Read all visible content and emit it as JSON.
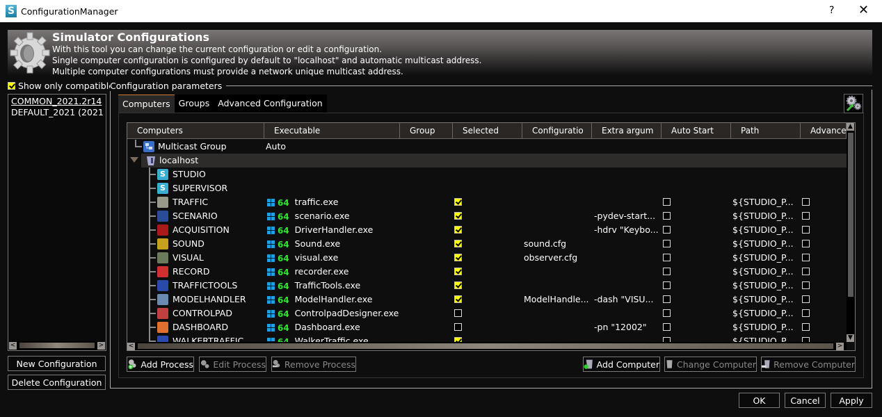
{
  "window": {
    "title": "ConfigurationManager",
    "help": "?",
    "close": "✕"
  },
  "banner": {
    "title": "Simulator Configurations",
    "lines": [
      "With this tool you can change the current configuration or edit a configuration.",
      "Single computer configuration is configured by default to \"localhost\" and automatic multicast address.",
      "Multiple computer configurations must provide a network unique multicast address."
    ]
  },
  "left": {
    "show_only_compatible": {
      "label": "Show only compatible",
      "checked": true
    },
    "configurations": [
      "COMMON_2021.2r14",
      "DEFAULT_2021 (2021"
    ],
    "selected_index": 0,
    "new_button": "New Configuration",
    "delete_button": "Delete Configuration"
  },
  "params": {
    "group_title": "Configuration parameters",
    "tabs": [
      "Computers",
      "Groups",
      "Advanced Configuration"
    ],
    "active_tab": 0
  },
  "grid": {
    "columns": [
      "Computers",
      "Executable",
      "Group",
      "Selected",
      "Configuratio",
      "Extra argum",
      "Auto Start",
      "Path",
      "Advanced"
    ],
    "multicast": {
      "name": "Multicast Group",
      "value": "Auto"
    },
    "host": {
      "name": "localhost",
      "expanded": true
    },
    "processes": [
      {
        "name": "STUDIO",
        "icon": "studio-icon",
        "exe": "",
        "arch": "",
        "selected": null,
        "config": "",
        "args": "",
        "auto_start": null,
        "path": "",
        "advanced": null
      },
      {
        "name": "SUPERVISOR",
        "icon": "studio-icon",
        "exe": "",
        "arch": "",
        "selected": null,
        "config": "",
        "args": "",
        "auto_start": null,
        "path": "",
        "advanced": null
      },
      {
        "name": "TRAFFIC",
        "icon": "traffic-icon",
        "exe": "traffic.exe",
        "arch": "64",
        "selected": true,
        "config": "",
        "args": "",
        "auto_start": false,
        "path": "${STUDIO_P...",
        "advanced": false
      },
      {
        "name": "SCENARIO",
        "icon": "scenario-icon",
        "exe": "scenario.exe",
        "arch": "64",
        "selected": true,
        "config": "",
        "args": "-pydev-start...",
        "auto_start": false,
        "path": "${STUDIO_P...",
        "advanced": false
      },
      {
        "name": "ACQUISITION",
        "icon": "acquisition-icon",
        "exe": "DriverHandler.exe",
        "arch": "64",
        "selected": true,
        "config": "",
        "args": "-hdrv \"Keybo...",
        "auto_start": false,
        "path": "${STUDIO_P...",
        "advanced": false
      },
      {
        "name": "SOUND",
        "icon": "sound-icon",
        "exe": "Sound.exe",
        "arch": "64",
        "selected": true,
        "config": "sound.cfg",
        "args": "",
        "auto_start": false,
        "path": "${STUDIO_P...",
        "advanced": false
      },
      {
        "name": "VISUAL",
        "icon": "visual-icon",
        "exe": "visual.exe",
        "arch": "64",
        "selected": true,
        "config": "observer.cfg",
        "args": "",
        "auto_start": false,
        "path": "${STUDIO_P...",
        "advanced": false
      },
      {
        "name": "RECORD",
        "icon": "record-icon",
        "exe": "recorder.exe",
        "arch": "64",
        "selected": true,
        "config": "",
        "args": "",
        "auto_start": false,
        "path": "${STUDIO_P...",
        "advanced": false
      },
      {
        "name": "TRAFFICTOOLS",
        "icon": "traffictools-icon",
        "exe": "TrafficTools.exe",
        "arch": "64",
        "selected": true,
        "config": "",
        "args": "",
        "auto_start": false,
        "path": "${STUDIO_P...",
        "advanced": false
      },
      {
        "name": "MODELHANDLER",
        "icon": "modelhandler-icon",
        "exe": "ModelHandler.exe",
        "arch": "64",
        "selected": true,
        "config": "ModelHandle...",
        "args": "-dash \"VISU...",
        "auto_start": false,
        "path": "${STUDIO_P...",
        "advanced": false
      },
      {
        "name": "CONTROLPAD",
        "icon": "controlpad-icon",
        "exe": "ControlpadDesigner.exe",
        "arch": "64",
        "selected": false,
        "config": "",
        "args": "",
        "auto_start": false,
        "path": "${STUDIO_P...",
        "advanced": false
      },
      {
        "name": "DASHBOARD",
        "icon": "dashboard-icon",
        "exe": "Dashboard.exe",
        "arch": "64",
        "selected": false,
        "config": "",
        "args": "-pn \"12002\"",
        "auto_start": false,
        "path": "${STUDIO_P...",
        "advanced": false
      },
      {
        "name": "WALKERTRAFFIC",
        "icon": "walker-icon",
        "exe": "WalkerTraffic.exe",
        "arch": "64",
        "selected": true,
        "config": "",
        "args": "",
        "auto_start": false,
        "path": "${STUDIO_P...",
        "advanced": false
      }
    ]
  },
  "actions": {
    "add_process": "Add Process",
    "edit_process": "Edit Process",
    "remove_process": "Remove Process",
    "add_computer": "Add Computer",
    "change_computer": "Change Computer",
    "remove_computer": "Remove Computer"
  },
  "dialog": {
    "ok": "OK",
    "cancel": "Cancel",
    "apply": "Apply"
  }
}
